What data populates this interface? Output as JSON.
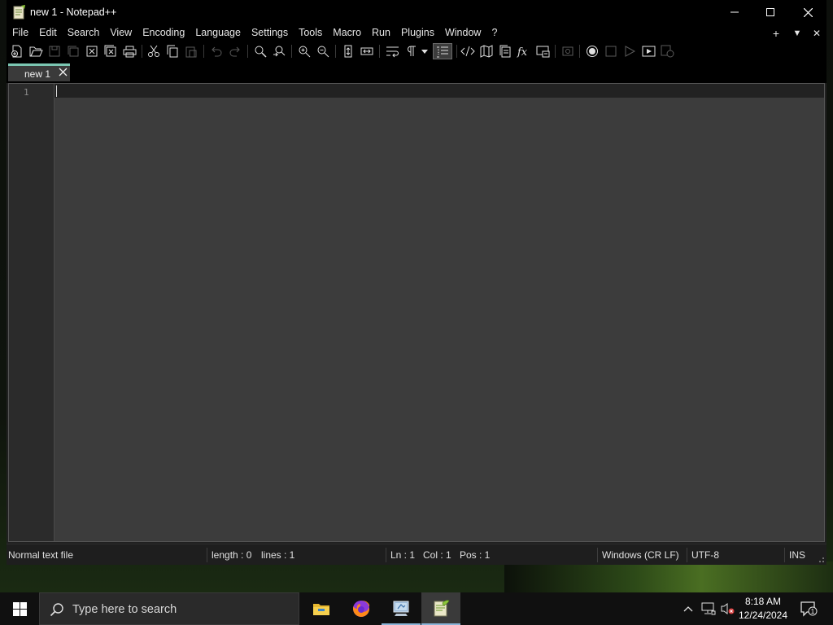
{
  "window": {
    "title": "new 1 - Notepad++"
  },
  "menu": {
    "items": [
      "File",
      "Edit",
      "Search",
      "View",
      "Encoding",
      "Language",
      "Settings",
      "Tools",
      "Macro",
      "Run",
      "Plugins",
      "Window",
      "?"
    ],
    "right_controls": [
      "+",
      "▼",
      "✕"
    ]
  },
  "toolbar": {
    "buttons": [
      "new-file",
      "open-file",
      "save",
      "save-all",
      "close",
      "close-all",
      "print",
      "cut",
      "copy",
      "paste",
      "undo",
      "redo",
      "find",
      "replace",
      "zoom-in",
      "zoom-out",
      "sync-vertical",
      "sync-horizontal",
      "word-wrap",
      "show-all-characters",
      "indent-guide",
      "document-map-list",
      "user-defined-language",
      "document-map",
      "document-list",
      "function-list",
      "folder-as-workspace",
      "monitoring",
      "record-macro",
      "stop-recording",
      "playback",
      "run-macro-multiple",
      "save-macro"
    ]
  },
  "tabs": [
    {
      "label": "new 1",
      "active": true
    }
  ],
  "editor": {
    "line_numbers": [
      "1"
    ],
    "content": ""
  },
  "status": {
    "file_type": "Normal text file",
    "length": "length : 0",
    "lines": "lines : 1",
    "ln": "Ln : 1",
    "col": "Col : 1",
    "pos": "Pos : 1",
    "eol": "Windows (CR LF)",
    "encoding": "UTF-8",
    "mode": "INS"
  },
  "taskbar": {
    "search_placeholder": "Type here to search",
    "apps": [
      "file-explorer",
      "firefox",
      "control-panel",
      "notepad-plus-plus"
    ],
    "clock_time": "8:18 AM",
    "clock_date": "12/24/2024",
    "notification_count": "1"
  },
  "colors": {
    "tab_accent": "#7bc6b2",
    "editor_bg": "#3c3c3c",
    "chrome_bg": "#000000",
    "taskbar_bg": "#101010"
  }
}
